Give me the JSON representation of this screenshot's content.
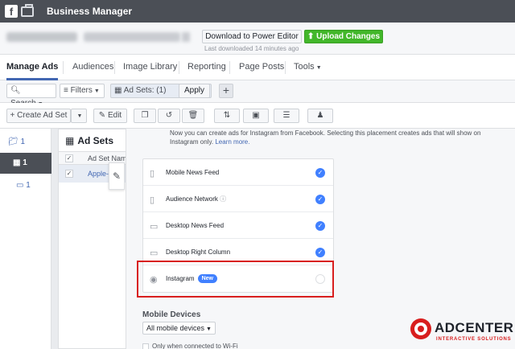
{
  "topbar": {
    "title": "Business Manager"
  },
  "account": {
    "download_label": "Download to Power Editor",
    "upload_label": "Upload Changes",
    "last_downloaded": "Last downloaded 14 minutes ago"
  },
  "nav": {
    "tabs": [
      "Manage Ads",
      "Audiences",
      "Image Library",
      "Reporting",
      "Page Posts",
      "Tools"
    ]
  },
  "filters": {
    "search_label": "Search",
    "filters_label": "Filters",
    "adsets_filter": "Ad Sets: (1)",
    "apply_label": "Apply",
    "plus": "+"
  },
  "toolbar": {
    "create_label": "Create Ad Set",
    "edit_label": "Edit"
  },
  "tree": {
    "items": [
      "1",
      "1",
      "1"
    ]
  },
  "adsets": {
    "title": "Ad Sets",
    "col_name": "Ad Set Name",
    "row_name": "Apple-M"
  },
  "panel": {
    "intro_text": "Now you can create ads for Instagram from Facebook. Selecting this placement creates ads that will show on Instagram only.",
    "learn_more": "Learn more.",
    "placements": [
      {
        "label": "Mobile News Feed",
        "icon": "mobile-icon",
        "checked": true
      },
      {
        "label": "Audience Network",
        "icon": "audience-network-icon",
        "checked": true
      },
      {
        "label": "Desktop News Feed",
        "icon": "desktop-icon",
        "checked": true
      },
      {
        "label": "Desktop Right Column",
        "icon": "desktop-icon",
        "checked": true
      },
      {
        "label": "Instagram",
        "icon": "instagram-icon",
        "checked": false
      }
    ],
    "new_badge": "New",
    "mobile_heading": "Mobile Devices",
    "mobile_dropdown": "All mobile devices",
    "wifi_label": "Only when connected to Wi-Fi"
  },
  "watermark": {
    "brand": "ADCENTER",
    "tagline": "INTERACTIVE SOLUTIONS"
  },
  "colors": {
    "topbar": "#4b4f56",
    "accent": "#4267b2",
    "check": "#4080ff",
    "upload": "#42b72a",
    "highlight": "#d81e1e"
  }
}
